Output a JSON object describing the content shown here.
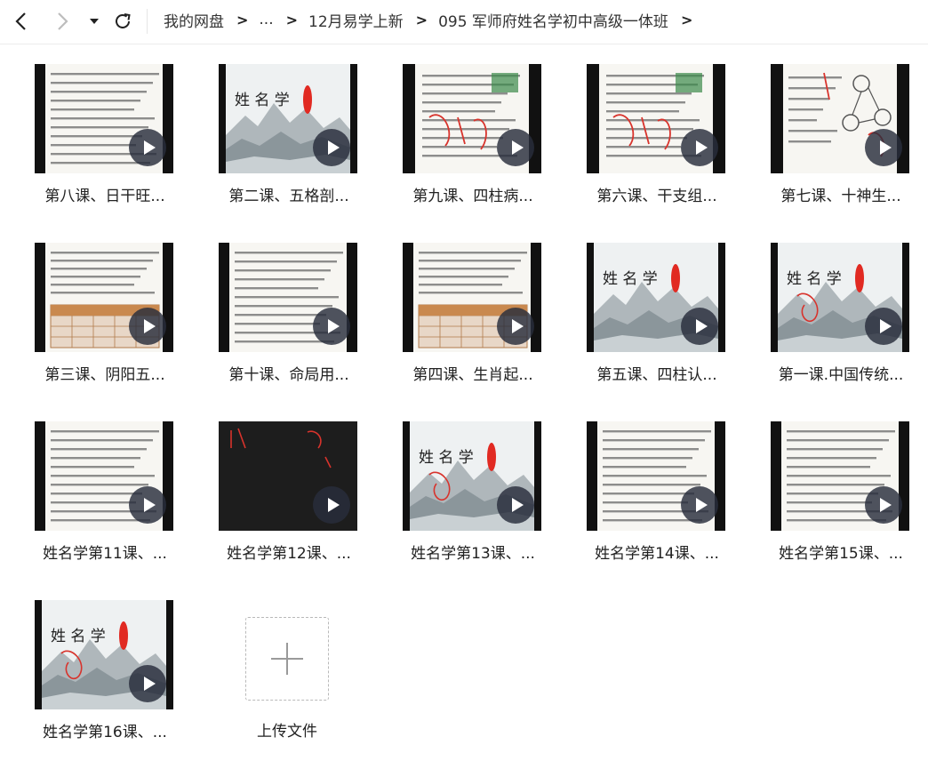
{
  "nav": {
    "breadcrumb": [
      "我的网盘",
      "...",
      "12月易学上新",
      "095 军师府姓名学初中高级一体班"
    ],
    "separator": ">"
  },
  "files": [
    {
      "label": "第八课、日干旺...",
      "thumb": "doc-text"
    },
    {
      "label": "第二课、五格剖...",
      "thumb": "landscape"
    },
    {
      "label": "第九课、四柱病...",
      "thumb": "doc-handwriting"
    },
    {
      "label": "第六课、干支组...",
      "thumb": "doc-handwriting"
    },
    {
      "label": "第七课、十神生...",
      "thumb": "doc-diagram"
    },
    {
      "label": "第三课、阴阳五...",
      "thumb": "doc-table"
    },
    {
      "label": "第十课、命局用...",
      "thumb": "doc-text"
    },
    {
      "label": "第四课、生肖起...",
      "thumb": "doc-table"
    },
    {
      "label": "第五课、四柱认...",
      "thumb": "landscape"
    },
    {
      "label": "第一课.中国传统...",
      "thumb": "landscape"
    },
    {
      "label": "姓名学第11课、...",
      "thumb": "doc-text"
    },
    {
      "label": "姓名学第12课、...",
      "thumb": "blackboard"
    },
    {
      "label": "姓名学第13课、...",
      "thumb": "landscape"
    },
    {
      "label": "姓名学第14课、...",
      "thumb": "doc-text"
    },
    {
      "label": "姓名学第15课、...",
      "thumb": "doc-text"
    },
    {
      "label": "姓名学第16课、...",
      "thumb": "landscape"
    }
  ],
  "upload": {
    "label": "上传文件"
  },
  "colors": {
    "accent": "#3a3f52",
    "ink_red": "#d8332c",
    "seal_red": "#e12a22"
  },
  "icons": {
    "back": "chevron-left-icon",
    "forward": "chevron-right-icon",
    "history": "caret-down-icon",
    "refresh": "refresh-icon",
    "play": "play-icon",
    "upload": "plus-icon"
  }
}
